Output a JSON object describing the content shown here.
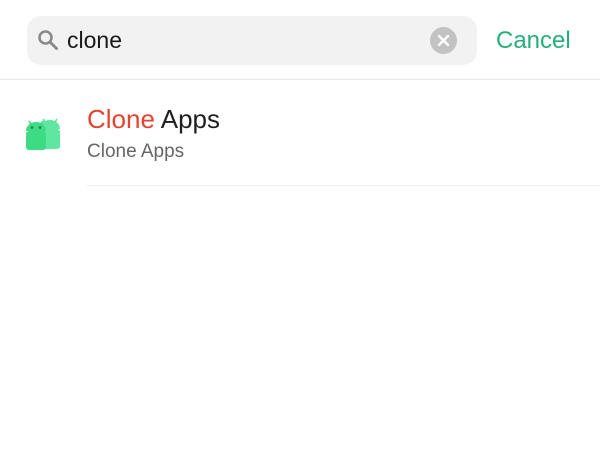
{
  "search": {
    "query": "clone",
    "cancel_label": "Cancel"
  },
  "results": [
    {
      "title_match": "Clone",
      "title_rest": " Apps",
      "subtitle": "Clone Apps",
      "icon": "android-clone-icon"
    }
  ],
  "colors": {
    "accent": "#25b07b",
    "highlight": "#e4432d",
    "icon_green": "#3ddc84"
  }
}
